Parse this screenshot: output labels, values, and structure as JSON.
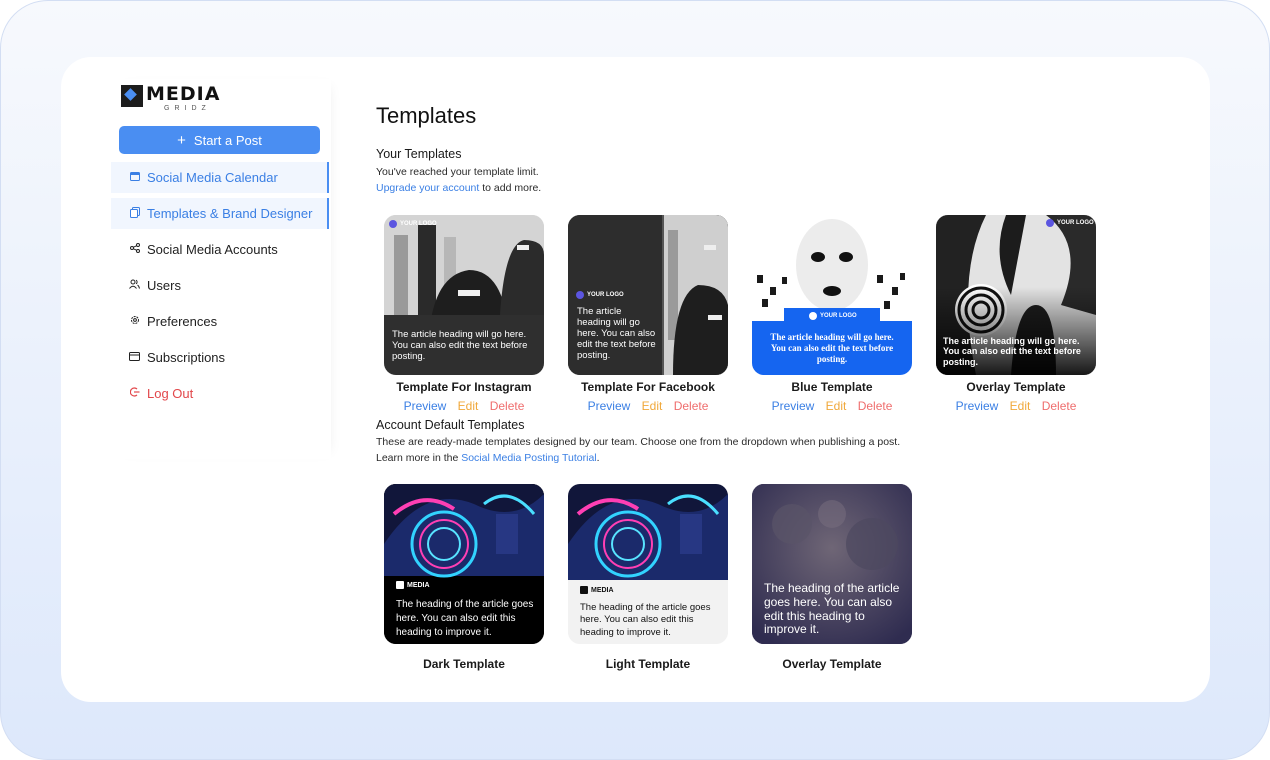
{
  "brand": {
    "name": "MEDIA",
    "sub": "GRIDZ"
  },
  "sidebar": {
    "start_post": "Start a Post",
    "items": [
      {
        "label": "Social Media Calendar",
        "icon": "calendar-icon",
        "active": true
      },
      {
        "label": "Templates & Brand Designer",
        "icon": "templates-icon",
        "active": true
      },
      {
        "label": "Social Media Accounts",
        "icon": "share-icon",
        "active": false
      },
      {
        "label": "Users",
        "icon": "users-icon",
        "active": false
      },
      {
        "label": "Preferences",
        "icon": "gear-icon",
        "active": false
      },
      {
        "label": "Subscriptions",
        "icon": "card-icon",
        "active": false
      },
      {
        "label": "Log Out",
        "icon": "logout-icon",
        "active": false
      }
    ]
  },
  "main": {
    "title": "Templates",
    "your_templates": {
      "heading": "Your Templates",
      "limit_text": "You've reached your template limit.",
      "upgrade_link": "Upgrade your account",
      "upgrade_suffix": " to add more.",
      "templates": [
        {
          "name": "Template For Instagram",
          "logo": "YOUR LOGO",
          "caption": "The article heading will go here. You can also edit the text before posting."
        },
        {
          "name": "Template For Facebook",
          "logo": "YOUR LOGO",
          "caption": "The article heading will go here. You can also edit the text before posting."
        },
        {
          "name": "Blue Template",
          "logo": "YOUR LOGO",
          "caption": "The article heading will go here. You can also edit the text before posting."
        },
        {
          "name": "Overlay Template",
          "logo": "YOUR LOGO",
          "caption": "The article heading will go here. You can also edit the text before posting."
        }
      ],
      "actions": {
        "preview": "Preview",
        "edit": "Edit",
        "delete": "Delete"
      }
    },
    "default_templates": {
      "heading": "Account Default Templates",
      "desc1": "These are ready-made templates designed by our team. Choose one from the dropdown when publishing a post.",
      "desc2_prefix": "Learn more in the ",
      "desc2_link": "Social Media Posting Tutorial",
      "desc2_suffix": ".",
      "templates": [
        {
          "name": "Dark Template",
          "logo": "MEDIA",
          "caption": "The heading of the article goes here. You can also edit this heading to improve it."
        },
        {
          "name": "Light Template",
          "logo": "MEDIA",
          "caption": "The heading of the article goes here. You can also edit this heading to improve it."
        },
        {
          "name": "Overlay Template",
          "logo": "",
          "caption": "The heading of the article goes here. You can also edit this heading to improve it."
        }
      ]
    }
  },
  "colors": {
    "accent": "#4a8ef2",
    "edit": "#f0a83a",
    "delete": "#ef6d6d",
    "logout": "#e2474b",
    "blue_template": "#1565f0"
  }
}
